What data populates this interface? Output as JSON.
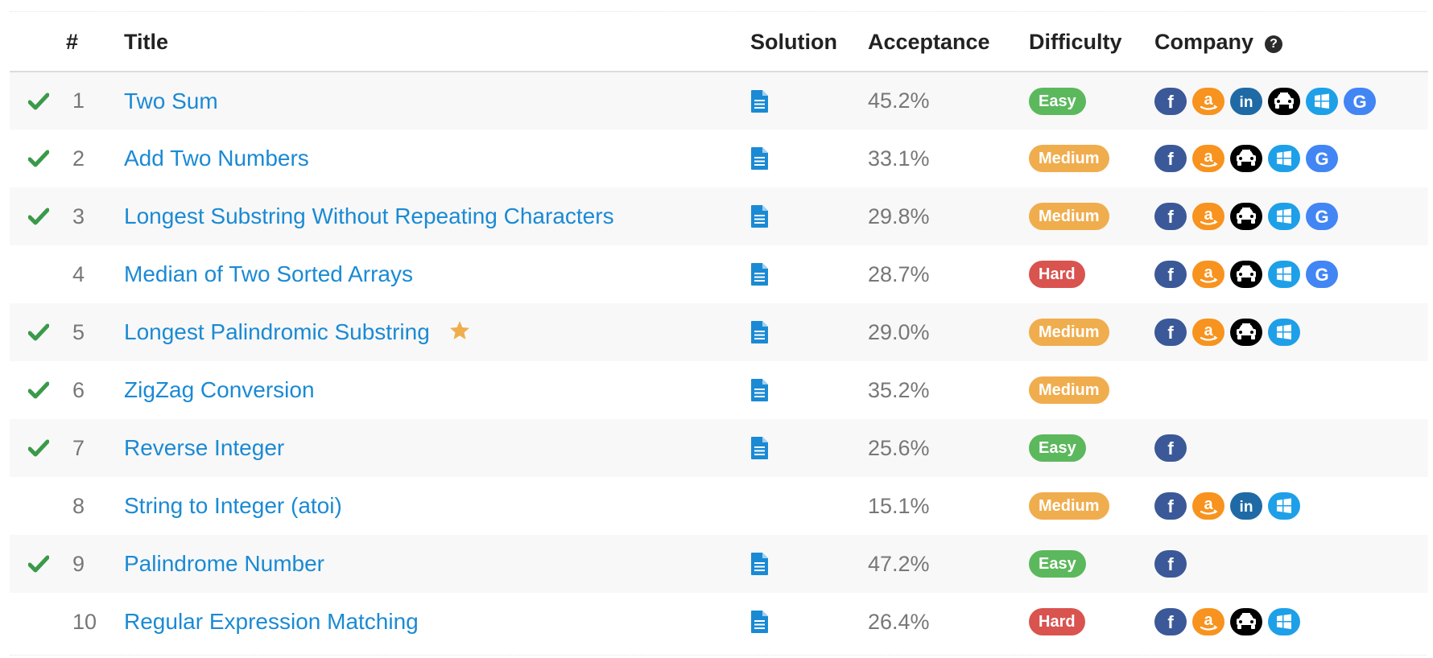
{
  "table": {
    "headers": {
      "number": "#",
      "title": "Title",
      "solution": "Solution",
      "acceptance": "Acceptance",
      "difficulty": "Difficulty",
      "company": "Company"
    },
    "help_icon": "?",
    "rows": [
      {
        "solved": true,
        "number": "1",
        "title": "Two Sum",
        "starred": false,
        "has_solution": true,
        "acceptance": "45.2%",
        "difficulty": "Easy",
        "companies": [
          "facebook",
          "amazon",
          "linkedin",
          "uber",
          "microsoft",
          "google"
        ]
      },
      {
        "solved": true,
        "number": "2",
        "title": "Add Two Numbers",
        "starred": false,
        "has_solution": true,
        "acceptance": "33.1%",
        "difficulty": "Medium",
        "companies": [
          "facebook",
          "amazon",
          "uber",
          "microsoft",
          "google"
        ]
      },
      {
        "solved": true,
        "number": "3",
        "title": "Longest Substring Without Repeating Characters",
        "starred": false,
        "has_solution": true,
        "acceptance": "29.8%",
        "difficulty": "Medium",
        "companies": [
          "facebook",
          "amazon",
          "uber",
          "microsoft",
          "google"
        ]
      },
      {
        "solved": false,
        "number": "4",
        "title": "Median of Two Sorted Arrays",
        "starred": false,
        "has_solution": true,
        "acceptance": "28.7%",
        "difficulty": "Hard",
        "companies": [
          "facebook",
          "amazon",
          "uber",
          "microsoft",
          "google"
        ]
      },
      {
        "solved": true,
        "number": "5",
        "title": "Longest Palindromic Substring",
        "starred": true,
        "has_solution": true,
        "acceptance": "29.0%",
        "difficulty": "Medium",
        "companies": [
          "facebook",
          "amazon",
          "uber",
          "microsoft"
        ]
      },
      {
        "solved": true,
        "number": "6",
        "title": "ZigZag Conversion",
        "starred": false,
        "has_solution": true,
        "acceptance": "35.2%",
        "difficulty": "Medium",
        "companies": []
      },
      {
        "solved": true,
        "number": "7",
        "title": "Reverse Integer",
        "starred": false,
        "has_solution": true,
        "acceptance": "25.6%",
        "difficulty": "Easy",
        "companies": [
          "facebook"
        ]
      },
      {
        "solved": false,
        "number": "8",
        "title": "String to Integer (atoi)",
        "starred": false,
        "has_solution": false,
        "acceptance": "15.1%",
        "difficulty": "Medium",
        "companies": [
          "facebook",
          "amazon",
          "linkedin",
          "microsoft"
        ]
      },
      {
        "solved": true,
        "number": "9",
        "title": "Palindrome Number",
        "starred": false,
        "has_solution": true,
        "acceptance": "47.2%",
        "difficulty": "Easy",
        "companies": [
          "facebook"
        ]
      },
      {
        "solved": false,
        "number": "10",
        "title": "Regular Expression Matching",
        "starred": false,
        "has_solution": true,
        "acceptance": "26.4%",
        "difficulty": "Hard",
        "companies": [
          "facebook",
          "amazon",
          "uber",
          "microsoft"
        ]
      }
    ]
  },
  "colors": {
    "check": "#3a9a4a",
    "link": "#1a8ad4",
    "star": "#f0ad4e",
    "doc": "#1a8ad4",
    "difficulty": {
      "Easy": "#5cb85c",
      "Medium": "#f0ad4e",
      "Hard": "#d9534f"
    },
    "companies": {
      "facebook": "#3b5998",
      "amazon": "#f7931e",
      "linkedin": "#1f6aa5",
      "uber": "#000000",
      "microsoft": "#1ea0e8",
      "google": "#4285f4"
    }
  },
  "icons": {
    "solved": "check-icon",
    "starred": "star-icon",
    "solution": "document-icon",
    "company_help": "question-circle-icon",
    "companies": {
      "facebook": "facebook-icon",
      "amazon": "amazon-icon",
      "linkedin": "linkedin-icon",
      "uber": "uber-car-icon",
      "microsoft": "microsoft-icon",
      "google": "google-icon"
    }
  }
}
